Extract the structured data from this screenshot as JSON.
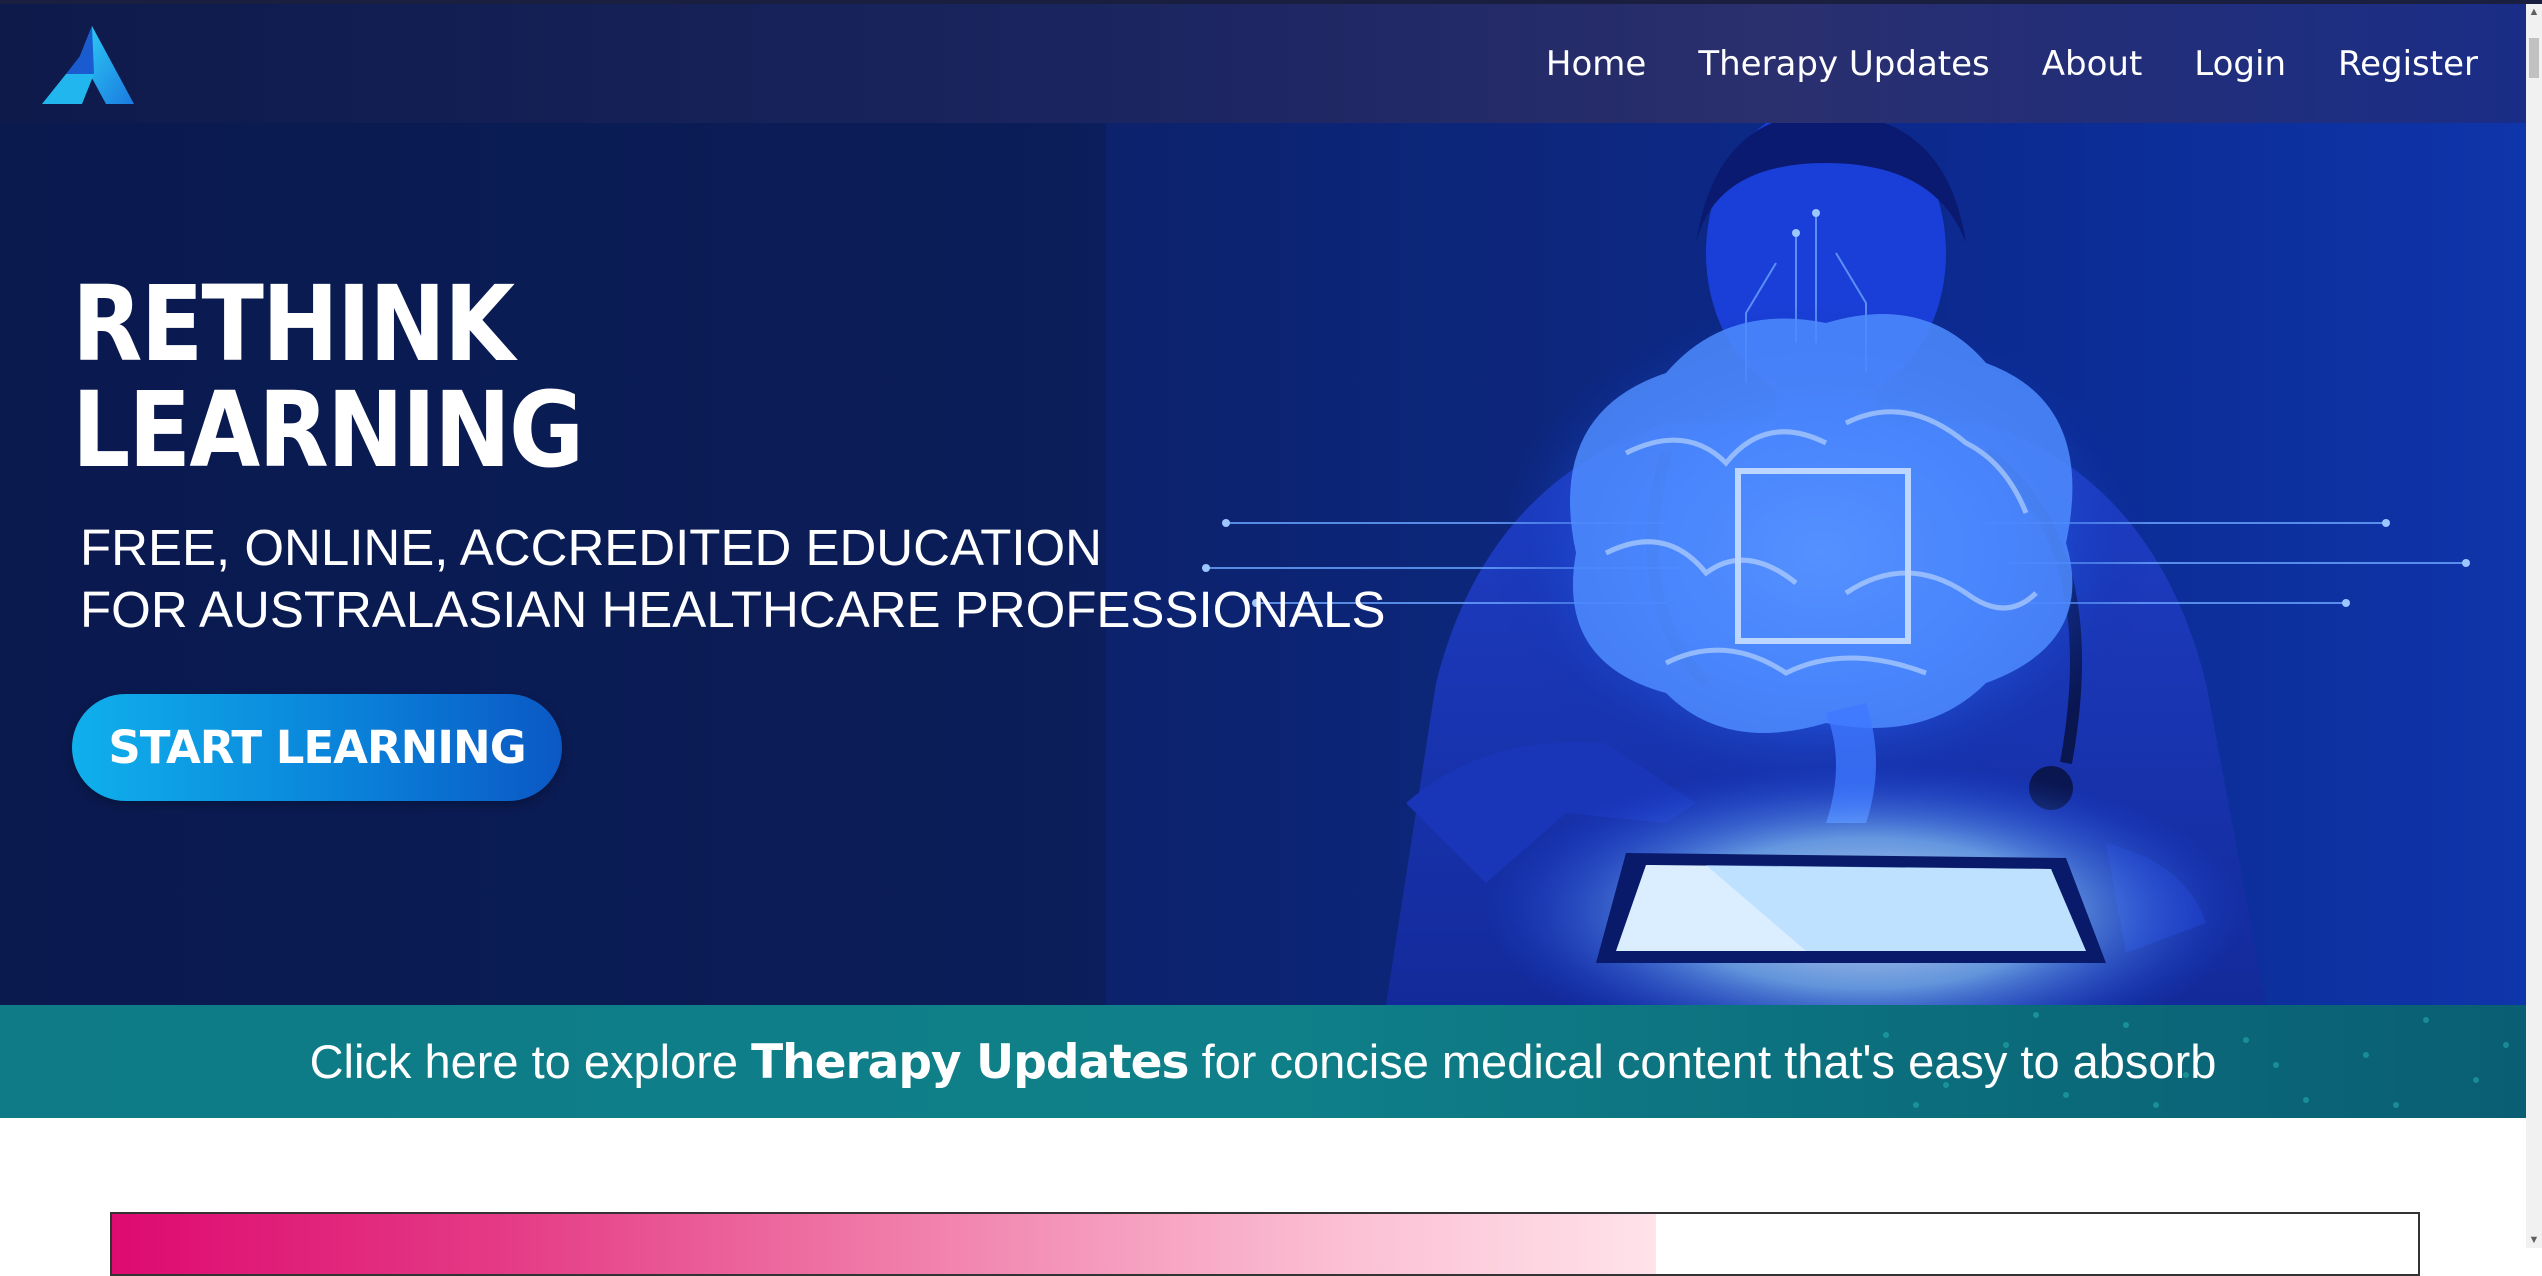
{
  "header": {
    "logo_icon": "triangle-logo-icon",
    "nav": {
      "home": "Home",
      "therapy_updates": "Therapy Updates",
      "about": "About",
      "login": "Login",
      "register": "Register"
    }
  },
  "hero": {
    "title_line1": "RETHINK",
    "title_line2": "LEARNING",
    "subtitle_line1": "FREE, ONLINE, ACCREDITED EDUCATION",
    "subtitle_line2": "FOR AUSTRALASIAN HEALTHCARE PROFESSIONALS",
    "cta_label": "START LEARNING",
    "image_subject": "doctor-with-glowing-brain-tablet"
  },
  "banner": {
    "prefix": "Click here to explore ",
    "highlight": "Therapy Updates",
    "suffix": " for concise medical content that's easy to absorb"
  },
  "colors": {
    "header_bg": "#1b2560",
    "hero_bg": "#0b1d58",
    "cta": "#0fb0ec",
    "banner_bg": "#0f8089",
    "next_strip": "#de0a70"
  }
}
